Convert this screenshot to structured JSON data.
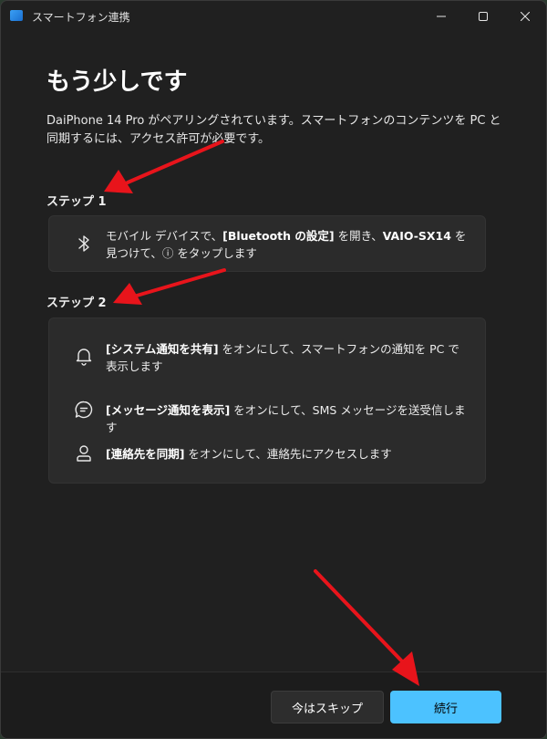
{
  "window": {
    "title": "スマートフォン連携",
    "heading": "もう少しです",
    "description": "DaiPhone 14 Pro がペアリングされています。スマートフォンのコンテンツを PC と同期するには、アクセス許可が必要です。"
  },
  "step1": {
    "label": "ステップ 1",
    "item": {
      "icon": "bluetooth-icon",
      "pre": "モバイル デバイスで、",
      "bold1": "[Bluetooth の設定]",
      "mid": " を開き、",
      "bold2": "VAIO-SX14",
      "post": " を見つけて、ⓘ をタップします"
    }
  },
  "step2": {
    "label": "ステップ 2",
    "items": [
      {
        "icon": "bell-icon",
        "bold": "[システム通知を共有]",
        "text": " をオンにして、スマートフォンの通知を PC で表示します"
      },
      {
        "icon": "message-icon",
        "bold": "[メッセージ通知を表示]",
        "text": " をオンにして、SMS メッセージを送受信します"
      },
      {
        "icon": "person-icon",
        "bold": "[連絡先を同期]",
        "text": " をオンにして、連絡先にアクセスします"
      }
    ]
  },
  "footer": {
    "skip_label": "今はスキップ",
    "continue_label": "続行"
  },
  "colors": {
    "accent": "#4cc2ff",
    "annotation_arrow": "#e8141b",
    "background": "#202020",
    "card": "#2b2b2b"
  }
}
